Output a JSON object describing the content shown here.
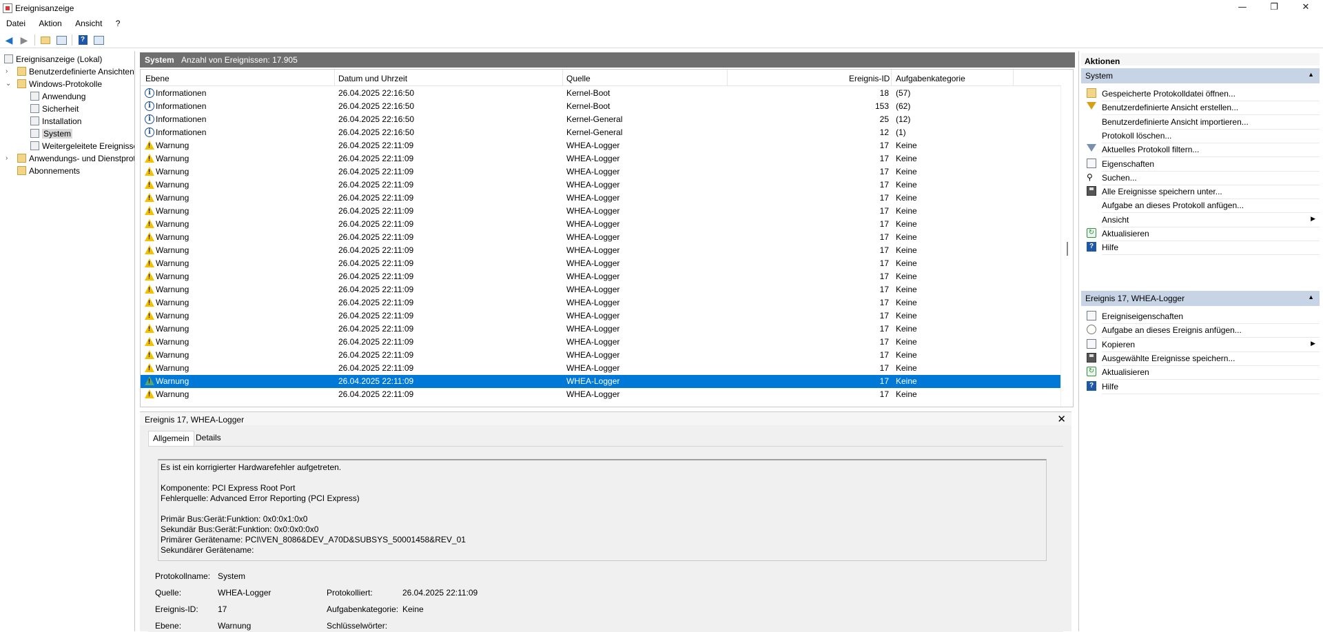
{
  "window": {
    "title": "Ereignisanzeige",
    "minimize": "—",
    "maximize": "❐",
    "close": "✕"
  },
  "menu": [
    "Datei",
    "Aktion",
    "Ansicht",
    "?"
  ],
  "tree": {
    "root": "Ereignisanzeige (Lokal)",
    "custom_views": "Benutzerdefinierte Ansichten",
    "windows_logs": "Windows-Protokolle",
    "logs": [
      "Anwendung",
      "Sicherheit",
      "Installation",
      "System",
      "Weitergeleitete Ereignisse"
    ],
    "app_service_logs": "Anwendungs- und Dienstprotokolle",
    "subscriptions": "Abonnements"
  },
  "center": {
    "title": "System",
    "count": "Anzahl von Ereignissen: 17.905",
    "columns": [
      "Ebene",
      "Datum und Uhrzeit",
      "Quelle",
      "Ereignis-ID",
      "Aufgabenkategorie"
    ],
    "rows": [
      {
        "level": "Informationen",
        "type": "info",
        "date": "26.04.2025 22:16:50",
        "source": "Kernel-Boot",
        "id": "18",
        "category": "(57)"
      },
      {
        "level": "Informationen",
        "type": "info",
        "date": "26.04.2025 22:16:50",
        "source": "Kernel-Boot",
        "id": "153",
        "category": "(62)"
      },
      {
        "level": "Informationen",
        "type": "info",
        "date": "26.04.2025 22:16:50",
        "source": "Kernel-General",
        "id": "25",
        "category": "(12)"
      },
      {
        "level": "Informationen",
        "type": "info",
        "date": "26.04.2025 22:16:50",
        "source": "Kernel-General",
        "id": "12",
        "category": "(1)"
      },
      {
        "level": "Warnung",
        "type": "warn",
        "date": "26.04.2025 22:11:09",
        "source": "WHEA-Logger",
        "id": "17",
        "category": "Keine"
      },
      {
        "level": "Warnung",
        "type": "warn",
        "date": "26.04.2025 22:11:09",
        "source": "WHEA-Logger",
        "id": "17",
        "category": "Keine"
      },
      {
        "level": "Warnung",
        "type": "warn",
        "date": "26.04.2025 22:11:09",
        "source": "WHEA-Logger",
        "id": "17",
        "category": "Keine"
      },
      {
        "level": "Warnung",
        "type": "warn",
        "date": "26.04.2025 22:11:09",
        "source": "WHEA-Logger",
        "id": "17",
        "category": "Keine"
      },
      {
        "level": "Warnung",
        "type": "warn",
        "date": "26.04.2025 22:11:09",
        "source": "WHEA-Logger",
        "id": "17",
        "category": "Keine"
      },
      {
        "level": "Warnung",
        "type": "warn",
        "date": "26.04.2025 22:11:09",
        "source": "WHEA-Logger",
        "id": "17",
        "category": "Keine"
      },
      {
        "level": "Warnung",
        "type": "warn",
        "date": "26.04.2025 22:11:09",
        "source": "WHEA-Logger",
        "id": "17",
        "category": "Keine"
      },
      {
        "level": "Warnung",
        "type": "warn",
        "date": "26.04.2025 22:11:09",
        "source": "WHEA-Logger",
        "id": "17",
        "category": "Keine"
      },
      {
        "level": "Warnung",
        "type": "warn",
        "date": "26.04.2025 22:11:09",
        "source": "WHEA-Logger",
        "id": "17",
        "category": "Keine"
      },
      {
        "level": "Warnung",
        "type": "warn",
        "date": "26.04.2025 22:11:09",
        "source": "WHEA-Logger",
        "id": "17",
        "category": "Keine"
      },
      {
        "level": "Warnung",
        "type": "warn",
        "date": "26.04.2025 22:11:09",
        "source": "WHEA-Logger",
        "id": "17",
        "category": "Keine"
      },
      {
        "level": "Warnung",
        "type": "warn",
        "date": "26.04.2025 22:11:09",
        "source": "WHEA-Logger",
        "id": "17",
        "category": "Keine"
      },
      {
        "level": "Warnung",
        "type": "warn",
        "date": "26.04.2025 22:11:09",
        "source": "WHEA-Logger",
        "id": "17",
        "category": "Keine"
      },
      {
        "level": "Warnung",
        "type": "warn",
        "date": "26.04.2025 22:11:09",
        "source": "WHEA-Logger",
        "id": "17",
        "category": "Keine"
      },
      {
        "level": "Warnung",
        "type": "warn",
        "date": "26.04.2025 22:11:09",
        "source": "WHEA-Logger",
        "id": "17",
        "category": "Keine"
      },
      {
        "level": "Warnung",
        "type": "warn",
        "date": "26.04.2025 22:11:09",
        "source": "WHEA-Logger",
        "id": "17",
        "category": "Keine"
      },
      {
        "level": "Warnung",
        "type": "warn",
        "date": "26.04.2025 22:11:09",
        "source": "WHEA-Logger",
        "id": "17",
        "category": "Keine"
      },
      {
        "level": "Warnung",
        "type": "warn",
        "date": "26.04.2025 22:11:09",
        "source": "WHEA-Logger",
        "id": "17",
        "category": "Keine"
      },
      {
        "level": "Warnung",
        "type": "warn",
        "date": "26.04.2025 22:11:09",
        "source": "WHEA-Logger",
        "id": "17",
        "category": "Keine",
        "selected": true
      },
      {
        "level": "Warnung",
        "type": "warn",
        "date": "26.04.2025 22:11:09",
        "source": "WHEA-Logger",
        "id": "17",
        "category": "Keine"
      }
    ]
  },
  "detail": {
    "title": "Ereignis 17, WHEA-Logger",
    "close": "✕",
    "tabs": [
      "Allgemein",
      "Details"
    ],
    "description": [
      "Es ist ein korrigierter Hardwarefehler aufgetreten.",
      "",
      "Komponente: PCI Express Root Port",
      "Fehlerquelle: Advanced Error Reporting (PCI Express)",
      "",
      "Primär Bus:Gerät:Funktion: 0x0:0x1:0x0",
      "Sekundär Bus:Gerät:Funktion: 0x0:0x0:0x0",
      "Primärer Gerätename: PCI\\VEN_8086&DEV_A70D&SUBSYS_50001458&REV_01",
      "Sekundärer Gerätename:"
    ],
    "fields": {
      "log_name_label": "Protokollname:",
      "log_name": "System",
      "source_label": "Quelle:",
      "source": "WHEA-Logger",
      "logged_label": "Protokolliert:",
      "logged": "26.04.2025 22:11:09",
      "event_id_label": "Ereignis-ID:",
      "event_id": "17",
      "task_label": "Aufgabenkategorie:",
      "task": "Keine",
      "level_label": "Ebene:",
      "level": "Warnung",
      "keywords_label": "Schlüsselwörter:"
    }
  },
  "actions": {
    "title": "Aktionen",
    "section1": "System",
    "items1": [
      {
        "label": "Gespeicherte Protokolldatei öffnen...",
        "icon": "folder-open-icon"
      },
      {
        "label": "Benutzerdefinierte Ansicht erstellen...",
        "icon": "filter-create-icon"
      },
      {
        "label": "Benutzerdefinierte Ansicht importieren...",
        "icon": ""
      },
      {
        "label": "Protokoll löschen...",
        "icon": ""
      },
      {
        "label": "Aktuelles Protokoll filtern...",
        "icon": "filter-icon"
      },
      {
        "label": "Eigenschaften",
        "icon": "properties-icon"
      },
      {
        "label": "Suchen...",
        "icon": "binoculars-icon"
      },
      {
        "label": "Alle Ereignisse speichern unter...",
        "icon": "save-icon"
      },
      {
        "label": "Aufgabe an dieses Protokoll anfügen...",
        "icon": ""
      },
      {
        "label": "Ansicht",
        "icon": "",
        "submenu": true
      },
      {
        "label": "Aktualisieren",
        "icon": "refresh-icon"
      },
      {
        "label": "Hilfe",
        "icon": "help-icon"
      }
    ],
    "section2": "Ereignis 17, WHEA-Logger",
    "items2": [
      {
        "label": "Ereigniseigenschaften",
        "icon": "event-properties-icon"
      },
      {
        "label": "Aufgabe an dieses Ereignis anfügen...",
        "icon": "task-icon"
      },
      {
        "label": "Kopieren",
        "icon": "copy-icon",
        "submenu": true
      },
      {
        "label": "Ausgewählte Ereignisse speichern...",
        "icon": "save-icon"
      },
      {
        "label": "Aktualisieren",
        "icon": "refresh-icon"
      },
      {
        "label": "Hilfe",
        "icon": "help-icon"
      }
    ]
  }
}
